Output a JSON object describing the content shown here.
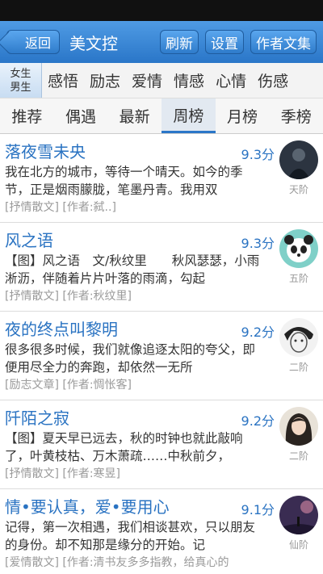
{
  "header": {
    "back_label": "返回",
    "title": "美文控",
    "refresh_label": "刷新",
    "settings_label": "设置",
    "author_label": "作者文集"
  },
  "gender": {
    "female": "女生",
    "male": "男生"
  },
  "categories": [
    "感悟",
    "励志",
    "爱情",
    "情感",
    "心情",
    "伤感"
  ],
  "tabs": [
    "推荐",
    "偶遇",
    "最新",
    "周榜",
    "月榜",
    "季榜"
  ],
  "active_tab": "周榜",
  "articles": [
    {
      "title": "落夜雪未央",
      "score": "9.3分",
      "body": "我在北方的城市，等待一个晴天。如今的季节，正是烟雨朦胧，笔墨丹青。我用双",
      "meta": "[抒情散文] [作者:弑..]",
      "level": "天阶",
      "avatar": "dark-figure"
    },
    {
      "title": "风之语",
      "score": "9.3分",
      "body": "【图】风之语　文/秋纹里　　秋风瑟瑟，小雨淅沥，伴随着片片叶落的雨滴，勾起",
      "meta": "[抒情散文] [作者:秋纹里]",
      "level": "五阶",
      "avatar": "panda"
    },
    {
      "title": "夜的终点叫黎明",
      "score": "9.2分",
      "body": "很多很多时候，我们就像追逐太阳的夸父，即便用尽全力的奔跑，却依然一无所",
      "meta": "[励志文章] [作者:惆怅客]",
      "level": "二阶",
      "avatar": "sketch-face"
    },
    {
      "title": "阡陌之寂",
      "score": "9.2分",
      "body": "【图】夏天早已远去，秋的时钟也就此敲响了，叶黄枝枯、万木萧疏……中秋前夕，",
      "meta": "[抒情散文] [作者:寒昱]",
      "level": "二阶",
      "avatar": "girl-portrait"
    },
    {
      "title": "情•要认真，爱•要用心",
      "score": "9.1分",
      "body": "记得，第一次相遇，我们相谈甚欢，只以朋友的身份。却不知那是缘分的开始。记",
      "meta": "[爱情散文] [作者:清书友多多指教，给真心的",
      "level": "仙阶",
      "avatar": "night-sky"
    }
  ],
  "colors": {
    "accent": "#2a76c8",
    "title_blue": "#2a73c2"
  }
}
